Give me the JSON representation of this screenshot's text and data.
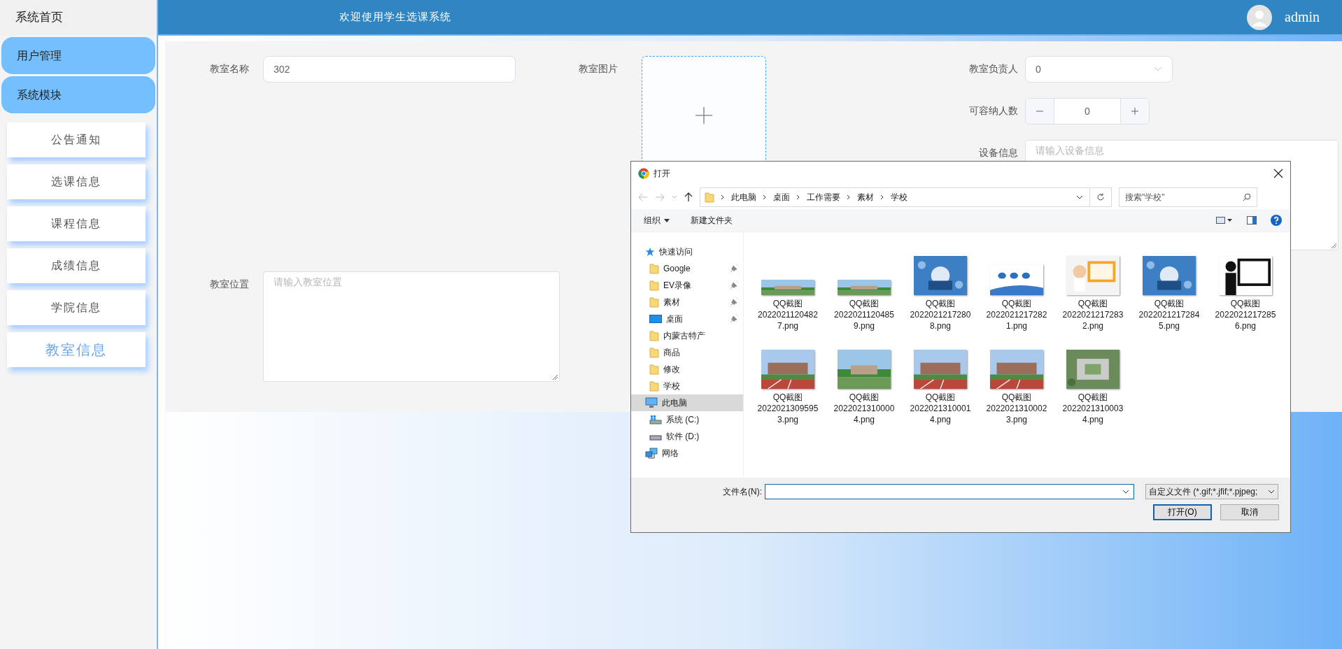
{
  "header": {
    "title": "欢迎使用学生选课系统",
    "user": "admin"
  },
  "sidebar": {
    "home": "系统首页",
    "menus": [
      {
        "label": "用户管理"
      },
      {
        "label": "系统模块"
      }
    ],
    "items": [
      {
        "label": "公告通知",
        "selected": false
      },
      {
        "label": "选课信息",
        "selected": false
      },
      {
        "label": "课程信息",
        "selected": false
      },
      {
        "label": "成绩信息",
        "selected": false
      },
      {
        "label": "学院信息",
        "selected": false
      },
      {
        "label": "教室信息",
        "selected": true
      }
    ]
  },
  "form": {
    "name": {
      "label": "教室名称",
      "value": "302"
    },
    "image": {
      "label": "教室图片"
    },
    "manager": {
      "label": "教室负责人",
      "value": "0"
    },
    "capacity": {
      "label": "可容纳人数",
      "value": "0"
    },
    "equipment": {
      "label": "设备信息",
      "placeholder": "请输入设备信息"
    },
    "location": {
      "label": "教室位置",
      "placeholder": "请输入教室位置"
    }
  },
  "dialog": {
    "title": "打开",
    "path": [
      "此电脑",
      "桌面",
      "工作需要",
      "素材",
      "学校"
    ],
    "search": {
      "placeholder": "搜索\"学校\""
    },
    "toolbar": [
      {
        "label": "组织",
        "kind": "menu"
      },
      {
        "label": "新建文件夹",
        "kind": "button"
      }
    ],
    "nav": [
      {
        "label": "快速访问",
        "kind": "star",
        "selected": false,
        "children": [
          {
            "label": "Google",
            "kind": "folder",
            "pinned": true,
            "selected": false
          },
          {
            "label": "EV录像",
            "kind": "folder",
            "pinned": true,
            "selected": false
          },
          {
            "label": "素材",
            "kind": "folder",
            "pinned": true,
            "selected": false
          },
          {
            "label": "桌面",
            "kind": "desktop",
            "pinned": true,
            "selected": false
          },
          {
            "label": "内蒙古特产",
            "kind": "folder",
            "pinned": false,
            "selected": false
          },
          {
            "label": "商品",
            "kind": "folder",
            "pinned": false,
            "selected": false
          },
          {
            "label": "修改",
            "kind": "folder",
            "pinned": false,
            "selected": false
          },
          {
            "label": "学校",
            "kind": "folder",
            "pinned": false,
            "selected": false
          }
        ]
      },
      {
        "label": "此电脑",
        "kind": "pc",
        "selected": true,
        "children": [
          {
            "label": "系统 (C:)",
            "kind": "system-drive",
            "selected": false
          },
          {
            "label": "软件 (D:)",
            "kind": "drive",
            "selected": false
          }
        ]
      },
      {
        "label": "网络",
        "kind": "network",
        "selected": false
      }
    ],
    "files": [
      {
        "name": "QQ截图20220211204827.png",
        "kind": "picture"
      },
      {
        "name": "QQ截图20220211204859.png",
        "kind": "picture"
      },
      {
        "name": "QQ截图20220212172808.png",
        "kind": "picture"
      },
      {
        "name": "QQ截图20220212172821.png",
        "kind": "picture"
      },
      {
        "name": "QQ截图20220212172832.png",
        "kind": "picture"
      },
      {
        "name": "QQ截图20220212172845.png",
        "kind": "picture"
      },
      {
        "name": "QQ截图20220212172856.png",
        "kind": "picture"
      },
      {
        "name": "QQ截图20220213095953.png",
        "kind": "picture"
      },
      {
        "name": "QQ截图20220213100004.png",
        "kind": "picture"
      },
      {
        "name": "QQ截图20220213100014.png",
        "kind": "picture"
      },
      {
        "name": "QQ截图20220213100023.png",
        "kind": "picture"
      },
      {
        "name": "QQ截图20220213100034.png",
        "kind": "picture"
      }
    ],
    "filename": {
      "label": "文件名(N):"
    },
    "filter": "自定义文件 (*.gif;*.jfif;*.pjpeg;",
    "buttons": [
      {
        "label": "打开(O)",
        "default": true
      },
      {
        "label": "取消",
        "default": false
      }
    ]
  }
}
